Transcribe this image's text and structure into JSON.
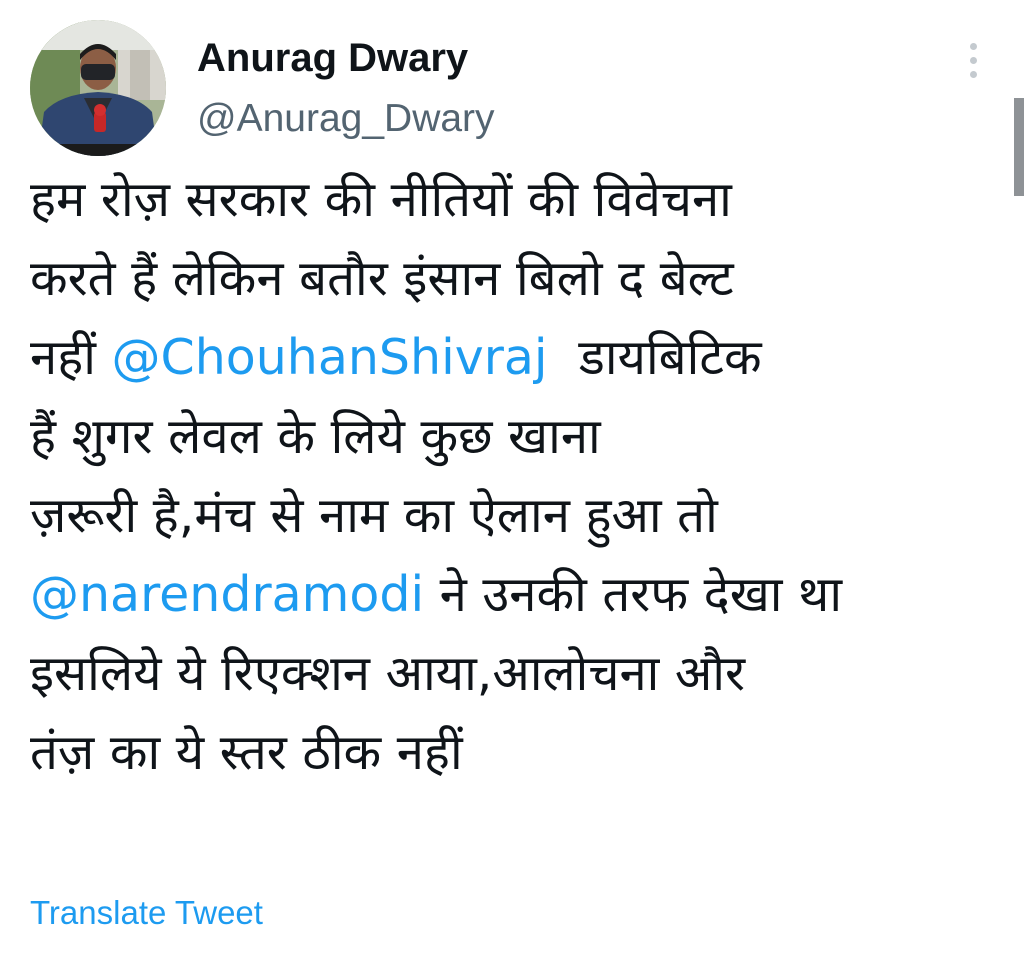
{
  "tweet": {
    "author": {
      "display_name": "Anurag Dwary",
      "handle": "@Anurag_Dwary",
      "avatar": "avatar-photo"
    },
    "more_icon": "more-vertical-icon",
    "lines": [
      {
        "text": "हम रोज़ सरकार की नीतियों की विवेचना"
      },
      {
        "text": "करते हैं लेकिन बतौर इंसान बिलो द बेल्ट"
      },
      {
        "pre": "नहीं ",
        "mention": "@ChouhanShivraj",
        "post": "  डायबिटिक"
      },
      {
        "text": "हैं शुगर लेवल के लिये कुछ खाना"
      },
      {
        "text": "ज़रूरी है,मंच से नाम का ऐलान हुआ तो"
      },
      {
        "mention": "@narendramodi",
        "post": " ने उनकी तरफ देखा था"
      },
      {
        "text": "इसलिये ये रिएक्शन आया,आलोचना और"
      },
      {
        "text": "तंज़ का ये स्तर ठीक नहीं"
      }
    ],
    "translate_label": "Translate Tweet"
  },
  "colors": {
    "text": "#0f1419",
    "secondary": "#536471",
    "link": "#1d9bf0",
    "background": "#ffffff"
  }
}
